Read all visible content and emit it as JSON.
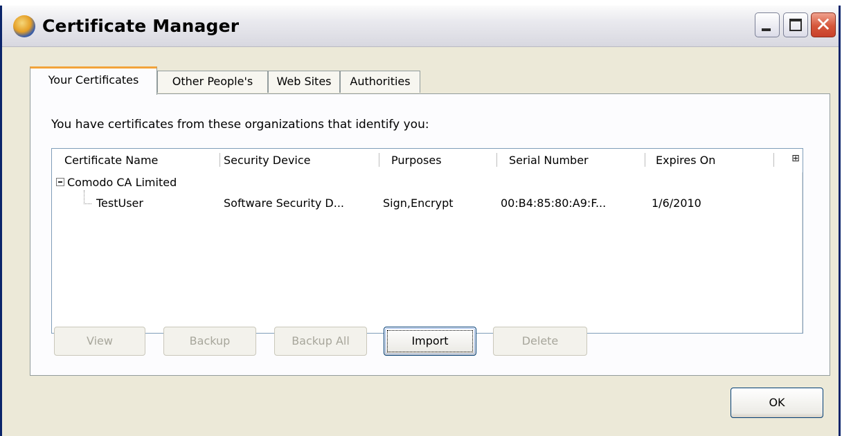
{
  "window": {
    "title": "Certificate Manager",
    "icon": "firefox-icon",
    "controls": [
      "minimize",
      "maximize",
      "close"
    ]
  },
  "tabs": [
    {
      "label": "Your Certificates",
      "active": true
    },
    {
      "label": "Other People's",
      "active": false
    },
    {
      "label": "Web Sites",
      "active": false
    },
    {
      "label": "Authorities",
      "active": false
    }
  ],
  "panel": {
    "intro": "You have certificates from these organizations that identify you:"
  },
  "table": {
    "columns": [
      "Certificate Name",
      "Security Device",
      "Purposes",
      "Serial Number",
      "Expires On"
    ],
    "groups": [
      {
        "name": "Comodo CA Limited",
        "expanded": true,
        "rows": [
          {
            "name": "TestUser",
            "device": "Software Security D...",
            "purposes": "Sign,Encrypt",
            "serial": "00:B4:85:80:A9:F...",
            "expires": "1/6/2010"
          }
        ]
      }
    ]
  },
  "buttons": {
    "view": "View",
    "backup": "Backup",
    "backup_all": "Backup All",
    "import": "Import",
    "delete": "Delete",
    "ok": "OK"
  }
}
